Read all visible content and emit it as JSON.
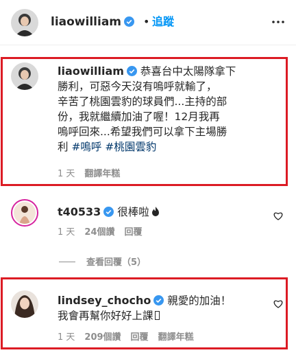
{
  "post_header": {
    "username": "liaowilliam",
    "separator": "•",
    "follow_label": "追蹤"
  },
  "comments": [
    {
      "username": "liaowilliam",
      "lines": [
        "恭喜台中太陽隊拿下",
        "勝利，可惡今天沒有嗚呼就輸了，",
        "辛苦了桃園雲豹的球員們...主持的部",
        "份，我就繼續加油了喔！12月我再",
        "嗚呼回來...希望我們可以拿下主場勝"
      ],
      "last_line_prefix": "利 ",
      "hashtags": [
        "#嗚呼",
        "#桃園雲豹"
      ],
      "time": "1 天",
      "translate": "翻譯年糕"
    },
    {
      "username": "t40533",
      "text": "很棒啦",
      "time": "1 天",
      "likes": "24個讚",
      "reply": "回覆"
    },
    {
      "username": "lindsey_chocho",
      "line1": "親愛的加油！",
      "line2": "我會再幫你好好上課",
      "time": "1 天",
      "likes": "209個讚",
      "reply": "回覆",
      "translate": "翻譯年糕"
    }
  ],
  "view_replies_label": "查看回覆（5）",
  "colors": {
    "highlight_border": "#dc1b24",
    "follow_blue": "#0095f6",
    "hashtag_blue": "#00376b",
    "verified_blue": "#3897f0",
    "secondary_gray": "#8e8e8e"
  },
  "icons": [
    "verified-badge-icon",
    "more-options-icon",
    "heart-icon",
    "flame-emoji-icon"
  ]
}
